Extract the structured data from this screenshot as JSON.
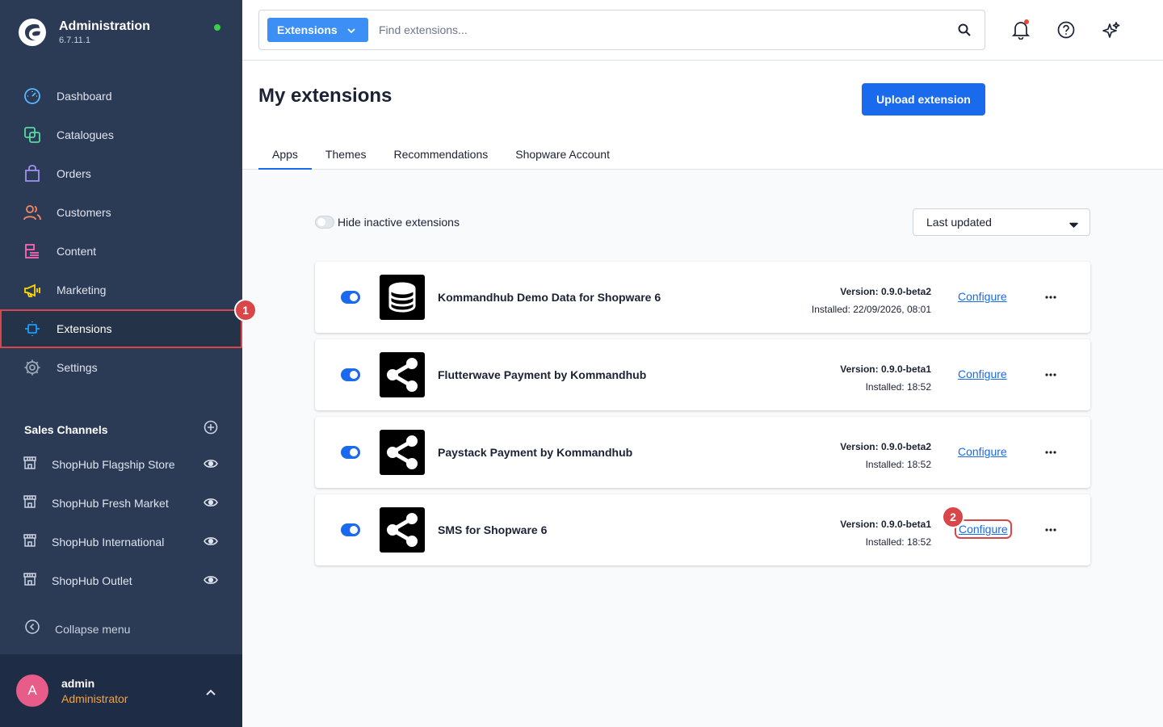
{
  "app": {
    "title": "Administration",
    "version": "6.7.11.1"
  },
  "nav": {
    "items": [
      {
        "label": "Dashboard",
        "icon": "dashboard-icon",
        "color": "#57b7ff"
      },
      {
        "label": "Catalogues",
        "icon": "catalogue-icon",
        "color": "#57d9a3"
      },
      {
        "label": "Orders",
        "icon": "orders-icon",
        "color": "#a092f0"
      },
      {
        "label": "Customers",
        "icon": "customers-icon",
        "color": "#f88962"
      },
      {
        "label": "Content",
        "icon": "content-icon",
        "color": "#ff68b4"
      },
      {
        "label": "Marketing",
        "icon": "marketing-icon",
        "color": "#ffd700"
      },
      {
        "label": "Extensions",
        "icon": "extensions-icon",
        "color": "#189eff"
      },
      {
        "label": "Settings",
        "icon": "settings-icon",
        "color": "#9aa8b5"
      }
    ]
  },
  "annotations": {
    "first": "1",
    "second": "2"
  },
  "sales_channels": {
    "title": "Sales Channels",
    "items": [
      {
        "label": "ShopHub Flagship Store"
      },
      {
        "label": "ShopHub Fresh Market"
      },
      {
        "label": "ShopHub International"
      },
      {
        "label": "ShopHub Outlet"
      }
    ]
  },
  "collapse_label": "Collapse menu",
  "user": {
    "initial": "A",
    "name": "admin",
    "role": "Administrator"
  },
  "search": {
    "type": "Extensions",
    "placeholder": "Find extensions..."
  },
  "page": {
    "title": "My extensions",
    "upload_label": "Upload extension",
    "tabs": [
      {
        "label": "Apps"
      },
      {
        "label": "Themes"
      },
      {
        "label": "Recommendations"
      },
      {
        "label": "Shopware Account"
      }
    ],
    "hide_inactive_label": "Hide inactive extensions",
    "sort_value": "Last updated"
  },
  "extensions": [
    {
      "name": "Kommandhub Demo Data for Shopware 6",
      "version": "Version: 0.9.0-beta2",
      "installed": "Installed: 22/09/2026, 08:01",
      "configure": "Configure",
      "logo": "database-icon",
      "active": true
    },
    {
      "name": "Flutterwave Payment by Kommandhub",
      "version": "Version: 0.9.0-beta1",
      "installed": "Installed: 18:52",
      "configure": "Configure",
      "logo": "share-nodes-icon",
      "active": true
    },
    {
      "name": "Paystack Payment by Kommandhub",
      "version": "Version: 0.9.0-beta2",
      "installed": "Installed: 18:52",
      "configure": "Configure",
      "logo": "share-nodes-icon",
      "active": true
    },
    {
      "name": "SMS for Shopware 6",
      "version": "Version: 0.9.0-beta1",
      "installed": "Installed: 18:52",
      "configure": "Configure",
      "logo": "share-nodes-icon",
      "active": true
    }
  ],
  "colors": {
    "sidebar": "#2b3a55",
    "accent": "#1a6aee",
    "highlight": "#d9464a"
  }
}
